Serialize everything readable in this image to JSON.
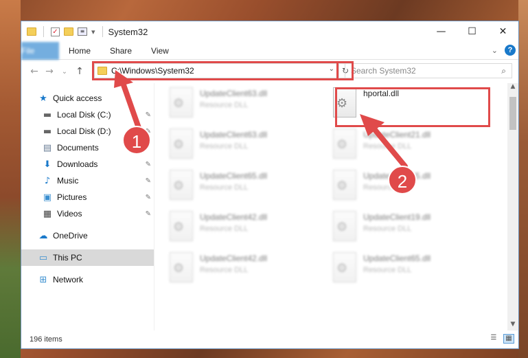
{
  "window": {
    "title": "System32"
  },
  "ribbon": {
    "tabs": [
      "File",
      "Home",
      "Share",
      "View"
    ]
  },
  "address": {
    "path": "C:\\Windows\\System32"
  },
  "search": {
    "placeholder": "Search System32"
  },
  "nav": {
    "quick_access": "Quick access",
    "items": [
      {
        "label": "Local Disk (C:)",
        "icon": "drive-icon",
        "pinned": true
      },
      {
        "label": "Local Disk (D:)",
        "icon": "drive-icon",
        "pinned": true
      },
      {
        "label": "Documents",
        "icon": "documents-icon",
        "pinned": false
      },
      {
        "label": "Downloads",
        "icon": "downloads-icon",
        "pinned": true
      },
      {
        "label": "Music",
        "icon": "music-icon",
        "pinned": true
      },
      {
        "label": "Pictures",
        "icon": "pictures-icon",
        "pinned": true
      },
      {
        "label": "Videos",
        "icon": "videos-icon",
        "pinned": true
      }
    ],
    "onedrive": "OneDrive",
    "this_pc": "This PC",
    "network": "Network"
  },
  "files": [
    {
      "name": "UpdateClient63.dll",
      "type": "Resource DLL"
    },
    {
      "name": "hportal.dll",
      "type": ""
    },
    {
      "name": "UpdateClient63.dll",
      "type": "Resource DLL"
    },
    {
      "name": "UpdateClient21.dll",
      "type": "Resource DLL"
    },
    {
      "name": "UpdateClient65.dll",
      "type": "Resource DLL"
    },
    {
      "name": "UpdateClient65.dll",
      "type": "Resource DLL"
    },
    {
      "name": "UpdateClient42.dll",
      "type": "Resource DLL"
    },
    {
      "name": "UpdateClient19.dll",
      "type": "Resource DLL"
    },
    {
      "name": "UpdateClient42.dll",
      "type": "Resource DLL"
    },
    {
      "name": "UpdateClient65.dll",
      "type": "Resource DLL"
    }
  ],
  "status": {
    "items": "196 items"
  },
  "annotations": {
    "badge1": "1",
    "badge2": "2"
  },
  "colors": {
    "accent": "#1979ca",
    "highlight": "#e04a4a"
  }
}
